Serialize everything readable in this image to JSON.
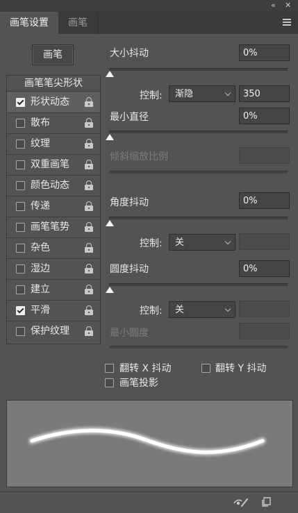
{
  "tabs": [
    {
      "label": "画笔设置",
      "active": true
    },
    {
      "label": "画笔",
      "active": false
    }
  ],
  "preset_button": "画笔",
  "left_panel": {
    "header": "画笔笔尖形状",
    "items": [
      {
        "label": "形状动态",
        "checked": true,
        "selected": true
      },
      {
        "label": "散布",
        "checked": false
      },
      {
        "label": "纹理",
        "checked": false
      },
      {
        "label": "双重画笔",
        "checked": false
      },
      {
        "label": "颜色动态",
        "checked": false
      },
      {
        "label": "传递",
        "checked": false
      },
      {
        "label": "画笔笔势",
        "checked": false
      },
      {
        "label": "杂色",
        "checked": false
      },
      {
        "label": "湿边",
        "checked": false
      },
      {
        "label": "建立",
        "checked": false
      },
      {
        "label": "平滑",
        "checked": true
      },
      {
        "label": "保护纹理",
        "checked": false
      }
    ]
  },
  "size_jitter": {
    "label": "大小抖动",
    "value": "0%",
    "control_label": "控制:",
    "control_value": "渐隐",
    "control_number": "350"
  },
  "min_diameter": {
    "label": "最小直径",
    "value": "0%"
  },
  "tilt_scale": {
    "label": "倾斜缩放比例",
    "value": ""
  },
  "angle_jitter": {
    "label": "角度抖动",
    "value": "0%",
    "control_label": "控制:",
    "control_value": "关"
  },
  "roundness_jitter": {
    "label": "圆度抖动",
    "value": "0%",
    "control_label": "控制:",
    "control_value": "关"
  },
  "min_roundness": {
    "label": "最小圆度",
    "value": ""
  },
  "checks": {
    "flip_x": "翻转 X 抖动",
    "flip_y": "翻转 Y 抖动",
    "brush_projection": "画笔投影"
  },
  "icons": {
    "collapse": "double-chevron-left-icon",
    "close": "close-icon",
    "menu": "hamburger-menu-icon",
    "toggle_preview": "eye-brush-icon",
    "new_preset": "new-preset-icon"
  },
  "colors": {
    "panel_bg": "#535353",
    "tabbar_bg": "#3b3b3b",
    "field_bg": "#454545",
    "preview_bg": "#7a7a7a"
  }
}
